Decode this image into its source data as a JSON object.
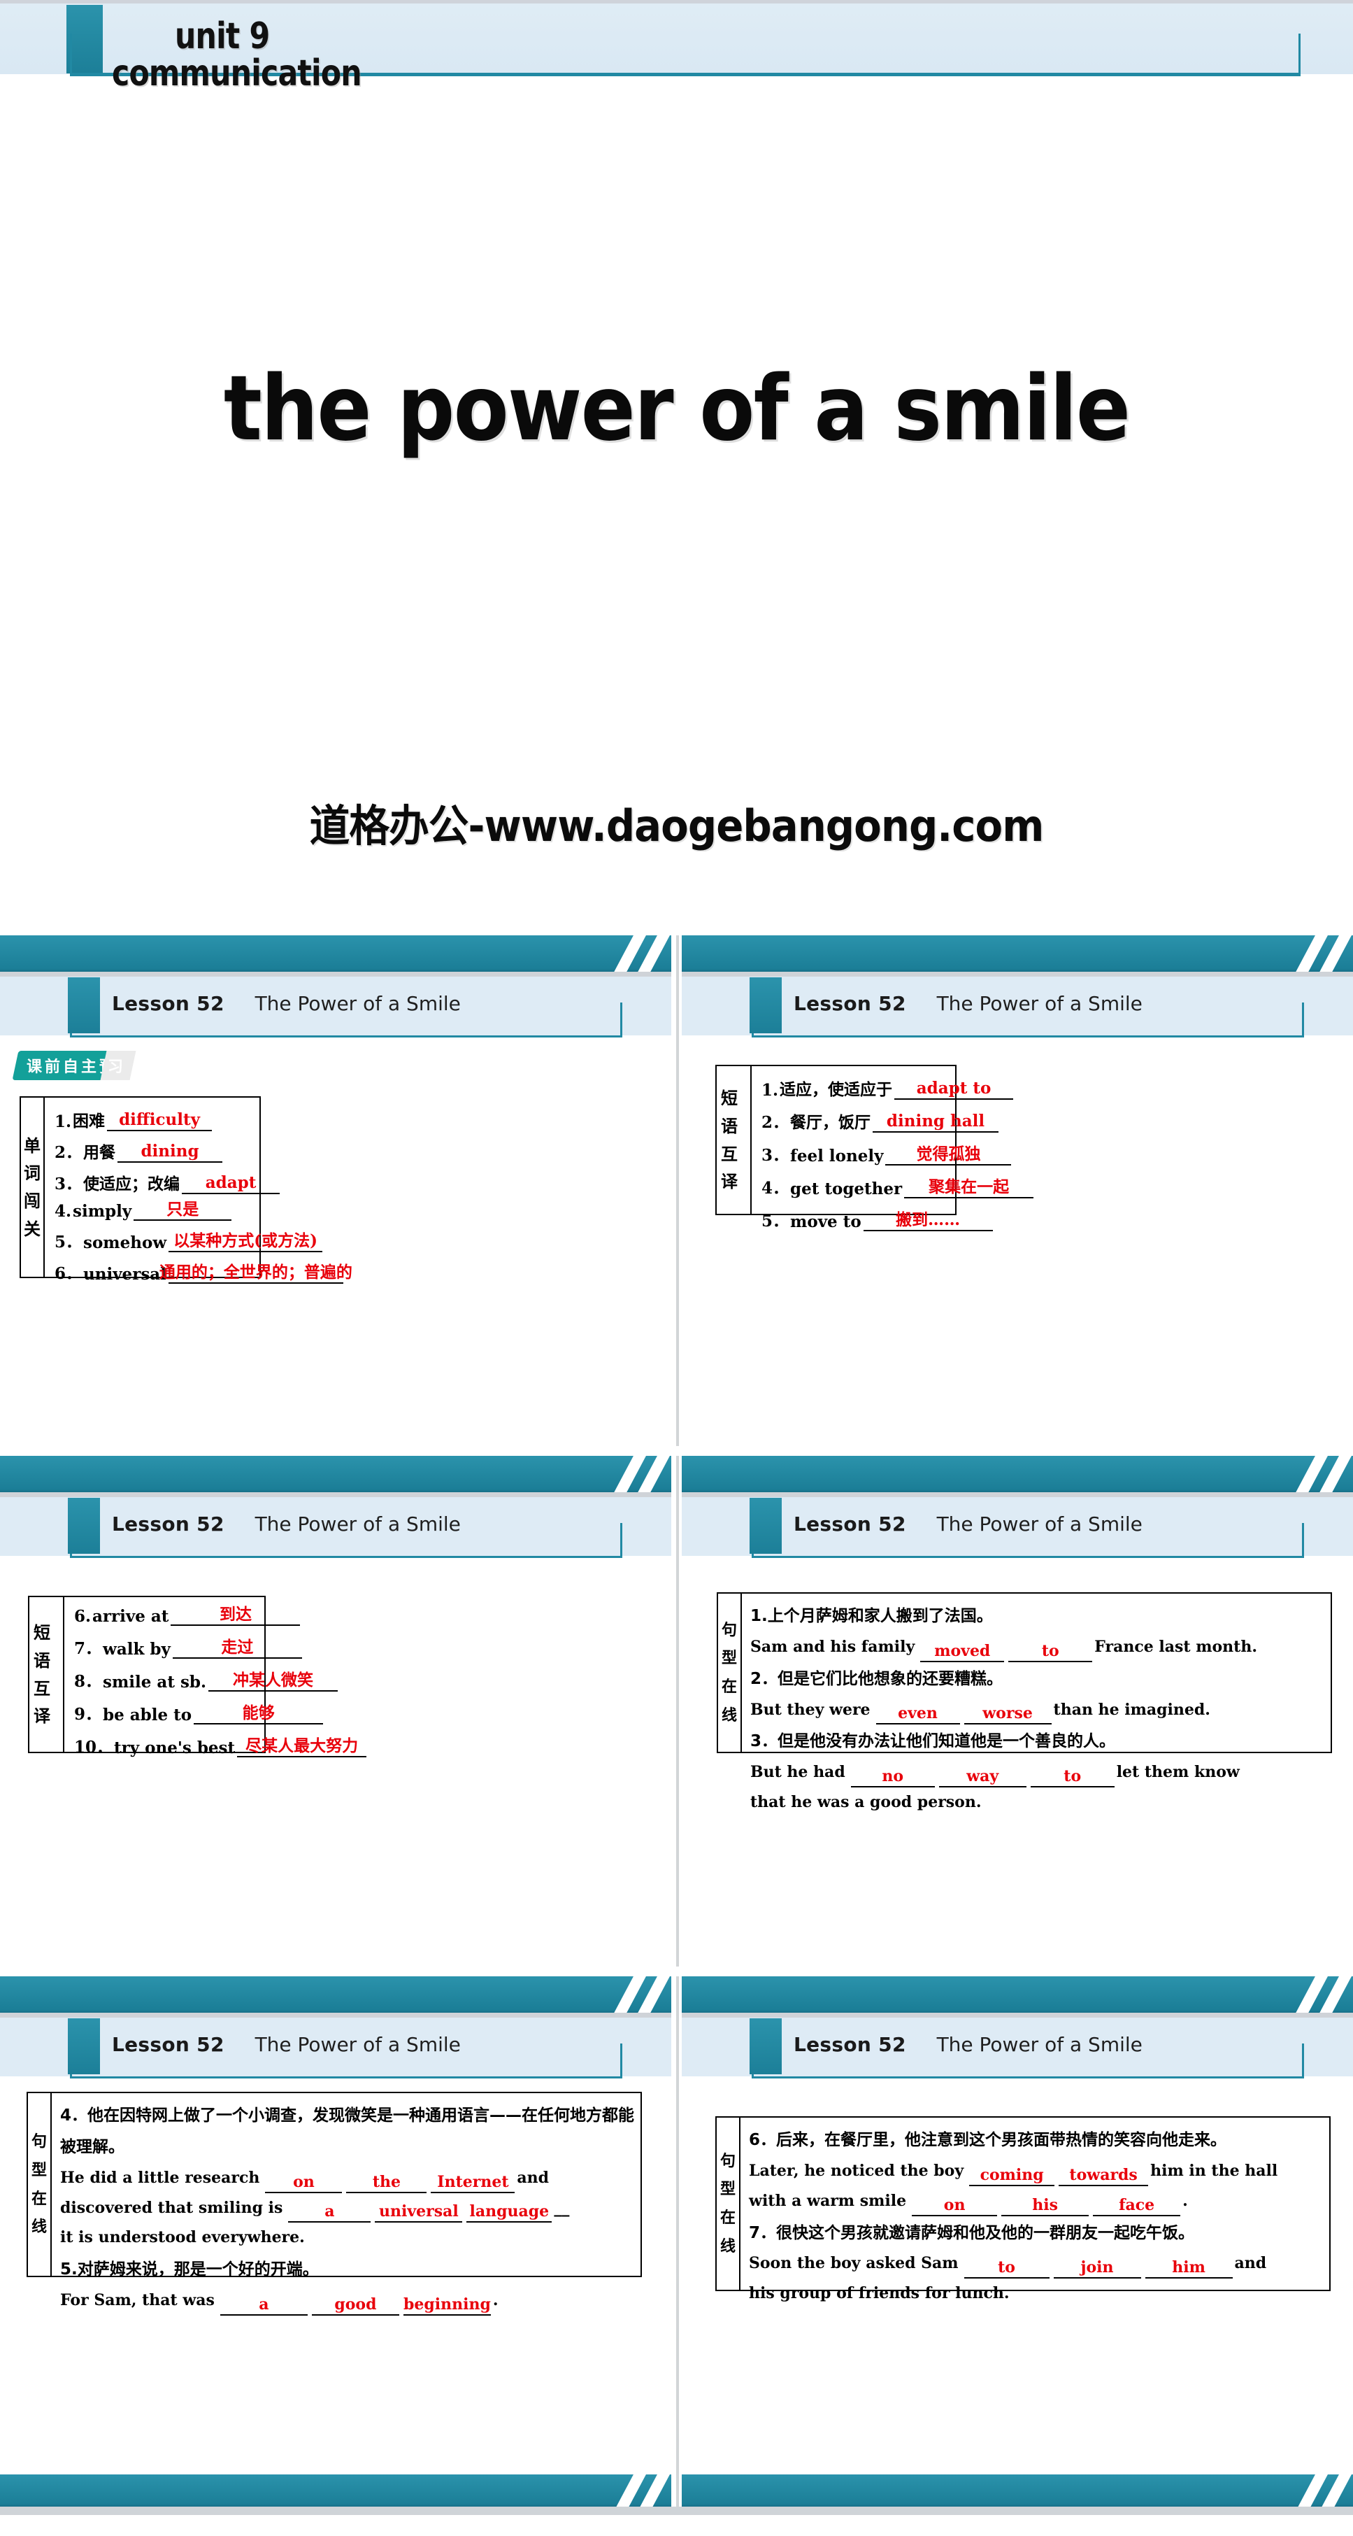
{
  "title_slide": {
    "unit_line1": "unit 9",
    "unit_line2": "communication",
    "main_title": "the power of a smile",
    "watermark": "道格办公-www.daogebangong.com"
  },
  "slide_header": {
    "lesson": "Lesson 52",
    "subtitle": "The Power of a Smile"
  },
  "badge": {
    "main": "课前自主预",
    "tail": "习"
  },
  "colors": {
    "teal": "#1e86a0",
    "header_blue": "#deebf5",
    "answer_red": "#e8000b",
    "badge_green": "#13a099"
  },
  "slides": [
    {
      "id": "slide-vocab",
      "label_col": "单词闯关",
      "label_chars": [
        "单",
        "词",
        "闯",
        "关"
      ],
      "rows": [
        {
          "num": "1.",
          "prompt": "困难",
          "answer": "difficulty",
          "blank_width": 150
        },
        {
          "num": "2．",
          "prompt": "用餐",
          "answer": "dining",
          "blank_width": 150
        },
        {
          "num": "3．",
          "prompt": "使适应；改编",
          "answer": "adapt",
          "blank_width": 140
        },
        {
          "num": "4.",
          "prompt": "simply",
          "answer": "只是",
          "blank_width": 140
        },
        {
          "num": "5．",
          "prompt": "somehow",
          "answer": "以某种方式(或方法)",
          "blank_width": 220
        },
        {
          "num": "6．",
          "prompt": "universal",
          "answer": "通用的；全世界的；普遍的",
          "blank_width": 250
        }
      ]
    },
    {
      "id": "slide-phrases-1",
      "label_col": "短语互译",
      "label_chars": [
        "短语",
        "互译"
      ],
      "rows": [
        {
          "num": "1.",
          "prompt": "适应，使适应于",
          "answer": "adapt to",
          "blank_width": 170
        },
        {
          "num": "2．",
          "prompt": "餐厅，饭厅",
          "answer": "dining hall",
          "blank_width": 180
        },
        {
          "num": "3．",
          "prompt": "feel lonely",
          "answer": "觉得孤独",
          "blank_width": 180
        },
        {
          "num": "4．",
          "prompt": "get together",
          "answer": "聚集在一起",
          "blank_width": 185
        },
        {
          "num": "5．",
          "prompt": "move to",
          "answer": "搬到……",
          "blank_width": 185
        }
      ]
    },
    {
      "id": "slide-phrases-2",
      "label_col": "短语互译",
      "label_chars": [
        "短语",
        "互译"
      ],
      "rows": [
        {
          "num": "6.",
          "prompt": "arrive at",
          "answer": "到达",
          "blank_width": 185
        },
        {
          "num": "7．",
          "prompt": "walk by",
          "answer": "走过",
          "blank_width": 185
        },
        {
          "num": "8．",
          "prompt": "smile at sb.",
          "answer": "冲某人微笑",
          "blank_width": 185
        },
        {
          "num": "9．",
          "prompt": "be able to",
          "answer": "能够",
          "blank_width": 185
        },
        {
          "num": "10．",
          "prompt": "try one's best",
          "answer": "尽某人最大努力",
          "blank_width": 185
        }
      ]
    },
    {
      "id": "slide-sentences-1",
      "label_col": "句型在线",
      "label_chars": [
        "句",
        "型",
        "在",
        "线"
      ],
      "items": [
        {
          "num": "1.",
          "cn": "上个月萨姆和家人搬到了法国。",
          "en_parts": [
            {
              "t": "text",
              "v": "Sam and his family"
            },
            {
              "t": "blank",
              "v": "moved",
              "w": 120
            },
            {
              "t": "blank",
              "v": "to",
              "w": 120
            },
            {
              "t": "text",
              "v": "France last month."
            }
          ]
        },
        {
          "num": "2．",
          "cn": "但是它们比他想象的还要糟糕。",
          "en_parts": [
            {
              "t": "text",
              "v": "But they were"
            },
            {
              "t": "blank",
              "v": "even",
              "w": 120
            },
            {
              "t": "blank",
              "v": "worse",
              "w": 125
            },
            {
              "t": "text",
              "v": "than he imagined."
            }
          ]
        },
        {
          "num": "3．",
          "cn": "但是他没有办法让他们知道他是一个善良的人。",
          "en_parts": [
            {
              "t": "text",
              "v": "But he had"
            },
            {
              "t": "blank",
              "v": "no",
              "w": 120
            },
            {
              "t": "blank",
              "v": "way",
              "w": 125
            },
            {
              "t": "blank",
              "v": "to",
              "w": 120
            },
            {
              "t": "text",
              "v": "let them know"
            },
            {
              "t": "break",
              "v": ""
            },
            {
              "t": "text",
              "v": "that he was a good person."
            }
          ]
        }
      ]
    },
    {
      "id": "slide-sentences-2",
      "label_col": "句型在线",
      "label_chars": [
        "句",
        "型",
        "在",
        "线"
      ],
      "items": [
        {
          "num": "4．",
          "cn": "他在因特网上做了一个小调查，发现微笑是一种通用语言——在任何地方都能被理解。",
          "en_parts": [
            {
              "t": "text",
              "v": "He did a little research"
            },
            {
              "t": "blank",
              "v": "on",
              "w": 110
            },
            {
              "t": "blank",
              "v": "the",
              "w": 115
            },
            {
              "t": "blank",
              "v": "Internet",
              "w": 120
            },
            {
              "t": "text",
              "v": "and"
            },
            {
              "t": "break",
              "v": ""
            },
            {
              "t": "text",
              "v": "discovered that smiling is"
            },
            {
              "t": "blank",
              "v": "a",
              "w": 118
            },
            {
              "t": "blank",
              "v": "universal",
              "w": 125
            },
            {
              "t": "blank",
              "v": "language",
              "w": 122
            },
            {
              "t": "text",
              "v": "__"
            },
            {
              "t": "break",
              "v": ""
            },
            {
              "t": "text",
              "v": "it is understood everywhere."
            }
          ]
        },
        {
          "num": "5.",
          "cn": "对萨姆来说，那是一个好的开端。",
          "en_parts": [
            {
              "t": "text",
              "v": "For Sam, that was"
            },
            {
              "t": "blank",
              "v": "a",
              "w": 125
            },
            {
              "t": "blank",
              "v": "good",
              "w": 125
            },
            {
              "t": "blank",
              "v": "beginning",
              "w": 125
            },
            {
              "t": "text",
              "v": "."
            }
          ]
        }
      ]
    },
    {
      "id": "slide-sentences-3",
      "label_col": "句型在线",
      "label_chars": [
        "句",
        "型",
        "在",
        "线"
      ],
      "items": [
        {
          "num": "6．",
          "cn": "后来，在餐厅里，他注意到这个男孩面带热情的笑容向他走来。",
          "en_parts": [
            {
              "t": "text",
              "v": "Later, he noticed the boy"
            },
            {
              "t": "blank",
              "v": "coming",
              "w": 122
            },
            {
              "t": "blank",
              "v": "towards",
              "w": 128
            },
            {
              "t": "text",
              "v": "him in the hall"
            },
            {
              "t": "break",
              "v": ""
            },
            {
              "t": "text",
              "v": "with a warm smile"
            },
            {
              "t": "blank",
              "v": "on",
              "w": 122
            },
            {
              "t": "blank",
              "v": "his",
              "w": 125
            },
            {
              "t": "blank",
              "v": "face",
              "w": 125
            },
            {
              "t": "text",
              "v": "."
            }
          ]
        },
        {
          "num": "7．",
          "cn": "很快这个男孩就邀请萨姆和他及他的一群朋友一起吃午饭。",
          "en_parts": [
            {
              "t": "text",
              "v": "Soon the boy asked Sam"
            },
            {
              "t": "blank",
              "v": "to",
              "w": 122
            },
            {
              "t": "blank",
              "v": "join",
              "w": 125
            },
            {
              "t": "blank",
              "v": "him",
              "w": 125
            },
            {
              "t": "text",
              "v": "and"
            },
            {
              "t": "break",
              "v": ""
            },
            {
              "t": "text",
              "v": "his group of friends for lunch."
            }
          ]
        }
      ]
    }
  ]
}
